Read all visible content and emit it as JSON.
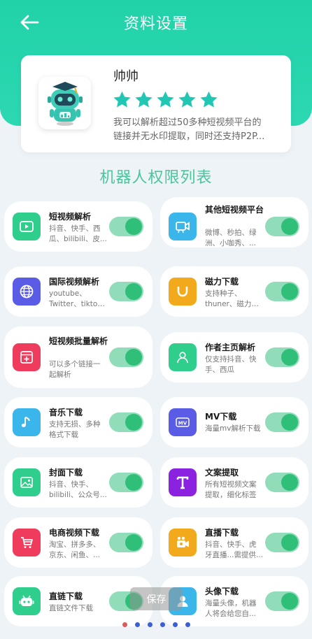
{
  "header": {
    "title": "资料设置",
    "back_icon": "arrow-left-icon",
    "color": "#26d4ad"
  },
  "profile": {
    "name": "帅帅",
    "rating": 5,
    "desc_line1": "我可以解析超过50多种短视频平台的",
    "desc_line2": "链接并无水印提取，同时还支持P2P..."
  },
  "section_title": "机器人权限列表",
  "permissions": [
    {
      "name": "短视频解析",
      "sub": [
        "抖音、快手、西",
        "瓜、bilibili、皮..."
      ],
      "icon": "video-play-icon",
      "color": "#2fce8d",
      "enabled": true
    },
    {
      "name": "其他短视频平台",
      "sub": [
        "微博、秒拍、绿",
        "洲、小咖秀、..."
      ],
      "icon": "video-camera-icon",
      "color": "#3bb6ea",
      "enabled": true
    },
    {
      "name": "国际视频解析",
      "sub": [
        "youtube、",
        "Twitter、tiktok..."
      ],
      "icon": "globe-icon",
      "color": "#5b5ce6",
      "enabled": true
    },
    {
      "name": "磁力下载",
      "sub": [
        "支持种子、",
        "thuner、磁力链..."
      ],
      "icon": "magnet-icon",
      "color": "#f2a91c",
      "enabled": true
    },
    {
      "name": "短视频批量解析",
      "sub": [
        "可以多个链接一",
        "起解析"
      ],
      "icon": "batch-add-icon",
      "color": "#f03c5c",
      "enabled": true
    },
    {
      "name": "作者主页解析",
      "sub": [
        "仅支持抖音、快",
        "手、西瓜"
      ],
      "icon": "user-icon",
      "color": "#2fce8d",
      "enabled": true
    },
    {
      "name": "音乐下载",
      "sub": [
        "支持无损、多种",
        "格式下载"
      ],
      "icon": "music-note-icon",
      "color": "#3bb6ea",
      "enabled": true
    },
    {
      "name": "MV下载",
      "sub": [
        "海量mv解析下载"
      ],
      "icon": "mv-icon",
      "color": "#5b5ce6",
      "enabled": true
    },
    {
      "name": "封面下载",
      "sub": [
        "抖音、快手、",
        "bilibili、公众号..."
      ],
      "icon": "image-icon",
      "color": "#2fce8d",
      "enabled": true
    },
    {
      "name": "文案提取",
      "sub": [
        "所有短视频文案",
        "提取，细化标签"
      ],
      "icon": "text-t-icon",
      "color": "#8b22e0",
      "enabled": true
    },
    {
      "name": "电商视频下载",
      "sub": [
        "淘宝、拼多多、",
        "京东、闲鱼、..."
      ],
      "icon": "shopping-cart-icon",
      "color": "#f03c5c",
      "enabled": true
    },
    {
      "name": "直播下载",
      "sub": [
        "抖音、快手、虎",
        "牙直播...需提供..."
      ],
      "icon": "live-camera-icon",
      "color": "#f2a91c",
      "enabled": true
    },
    {
      "name": "直链下载",
      "sub": [
        "直链文件下载"
      ],
      "icon": "robot-icon",
      "color": "#2fce8d",
      "enabled": true
    },
    {
      "name": "头像下载",
      "sub": [
        "海量头像，机器",
        "人将会给您自..."
      ],
      "icon": "avatar-user-icon",
      "color": "#3bb6ea",
      "enabled": true
    }
  ],
  "save_label": "保存",
  "pager": {
    "count": 6,
    "active": 0
  }
}
